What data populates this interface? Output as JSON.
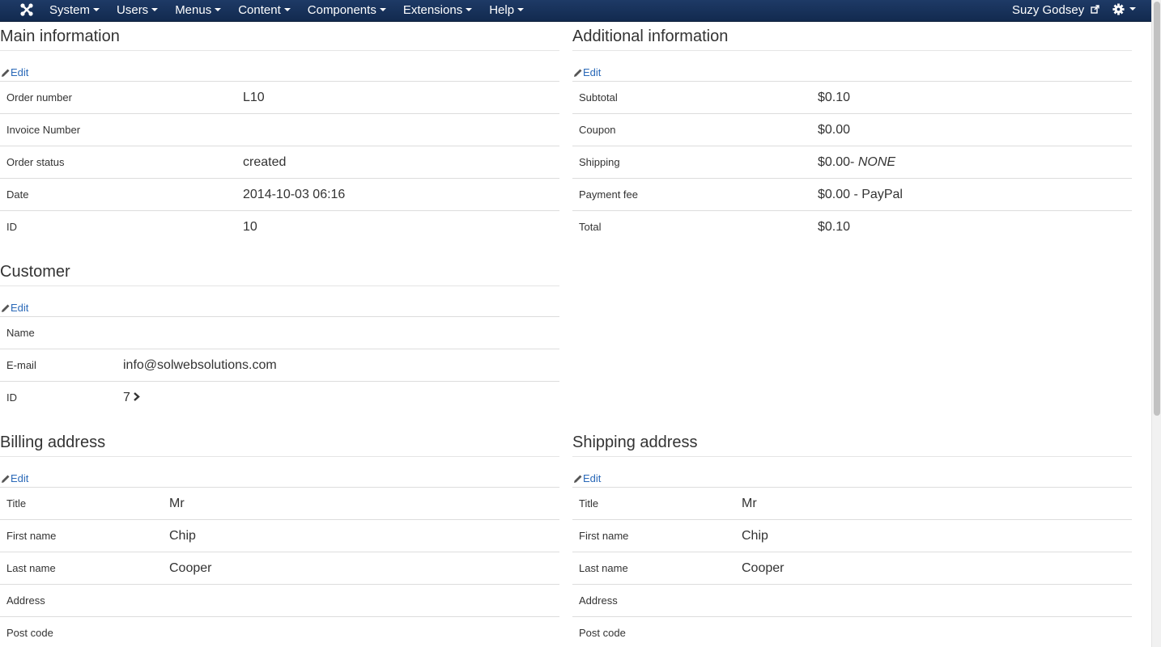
{
  "navbar": {
    "logo_icon": "joomla-logo-icon",
    "menu": [
      {
        "label": "System"
      },
      {
        "label": "Users"
      },
      {
        "label": "Menus"
      },
      {
        "label": "Content"
      },
      {
        "label": "Components"
      },
      {
        "label": "Extensions"
      },
      {
        "label": "Help"
      }
    ],
    "user_name": "Suzy Godsey",
    "user_icon": "external-link-icon",
    "settings_icon": "gear-icon"
  },
  "main_info": {
    "title": "Main information",
    "edit_label": "Edit",
    "rows": [
      {
        "label": "Order number",
        "value": "L10"
      },
      {
        "label": "Invoice Number",
        "value": ""
      },
      {
        "label": "Order status",
        "value": "created"
      },
      {
        "label": "Date",
        "value": "2014-10-03 06:16"
      },
      {
        "label": "ID",
        "value": "10"
      }
    ]
  },
  "additional_info": {
    "title": "Additional information",
    "edit_label": "Edit",
    "rows": [
      {
        "label": "Subtotal",
        "value": "$0.10"
      },
      {
        "label": "Coupon",
        "value": "$0.00"
      },
      {
        "label": "Shipping",
        "value": "$0.00- ",
        "value_em": "NONE"
      },
      {
        "label": "Payment fee",
        "value": "$0.00 - PayPal"
      },
      {
        "label": "Total",
        "value": "$0.10"
      }
    ]
  },
  "customer": {
    "title": "Customer",
    "edit_label": "Edit",
    "rows": [
      {
        "label": "Name",
        "value": ""
      },
      {
        "label": "E-mail",
        "value": "info@solwebsolutions.com"
      },
      {
        "label": "ID",
        "value": "7"
      }
    ]
  },
  "billing": {
    "title": "Billing address",
    "edit_label": "Edit",
    "rows": [
      {
        "label": "Title",
        "value": "Mr"
      },
      {
        "label": "First name",
        "value": "Chip"
      },
      {
        "label": "Last name",
        "value": "Cooper"
      },
      {
        "label": "Address",
        "value": ""
      },
      {
        "label": "Post code",
        "value": ""
      }
    ]
  },
  "shipping": {
    "title": "Shipping address",
    "edit_label": "Edit",
    "rows": [
      {
        "label": "Title",
        "value": "Mr"
      },
      {
        "label": "First name",
        "value": "Chip"
      },
      {
        "label": "Last name",
        "value": "Cooper"
      },
      {
        "label": "Address",
        "value": ""
      },
      {
        "label": "Post code",
        "value": ""
      }
    ]
  }
}
